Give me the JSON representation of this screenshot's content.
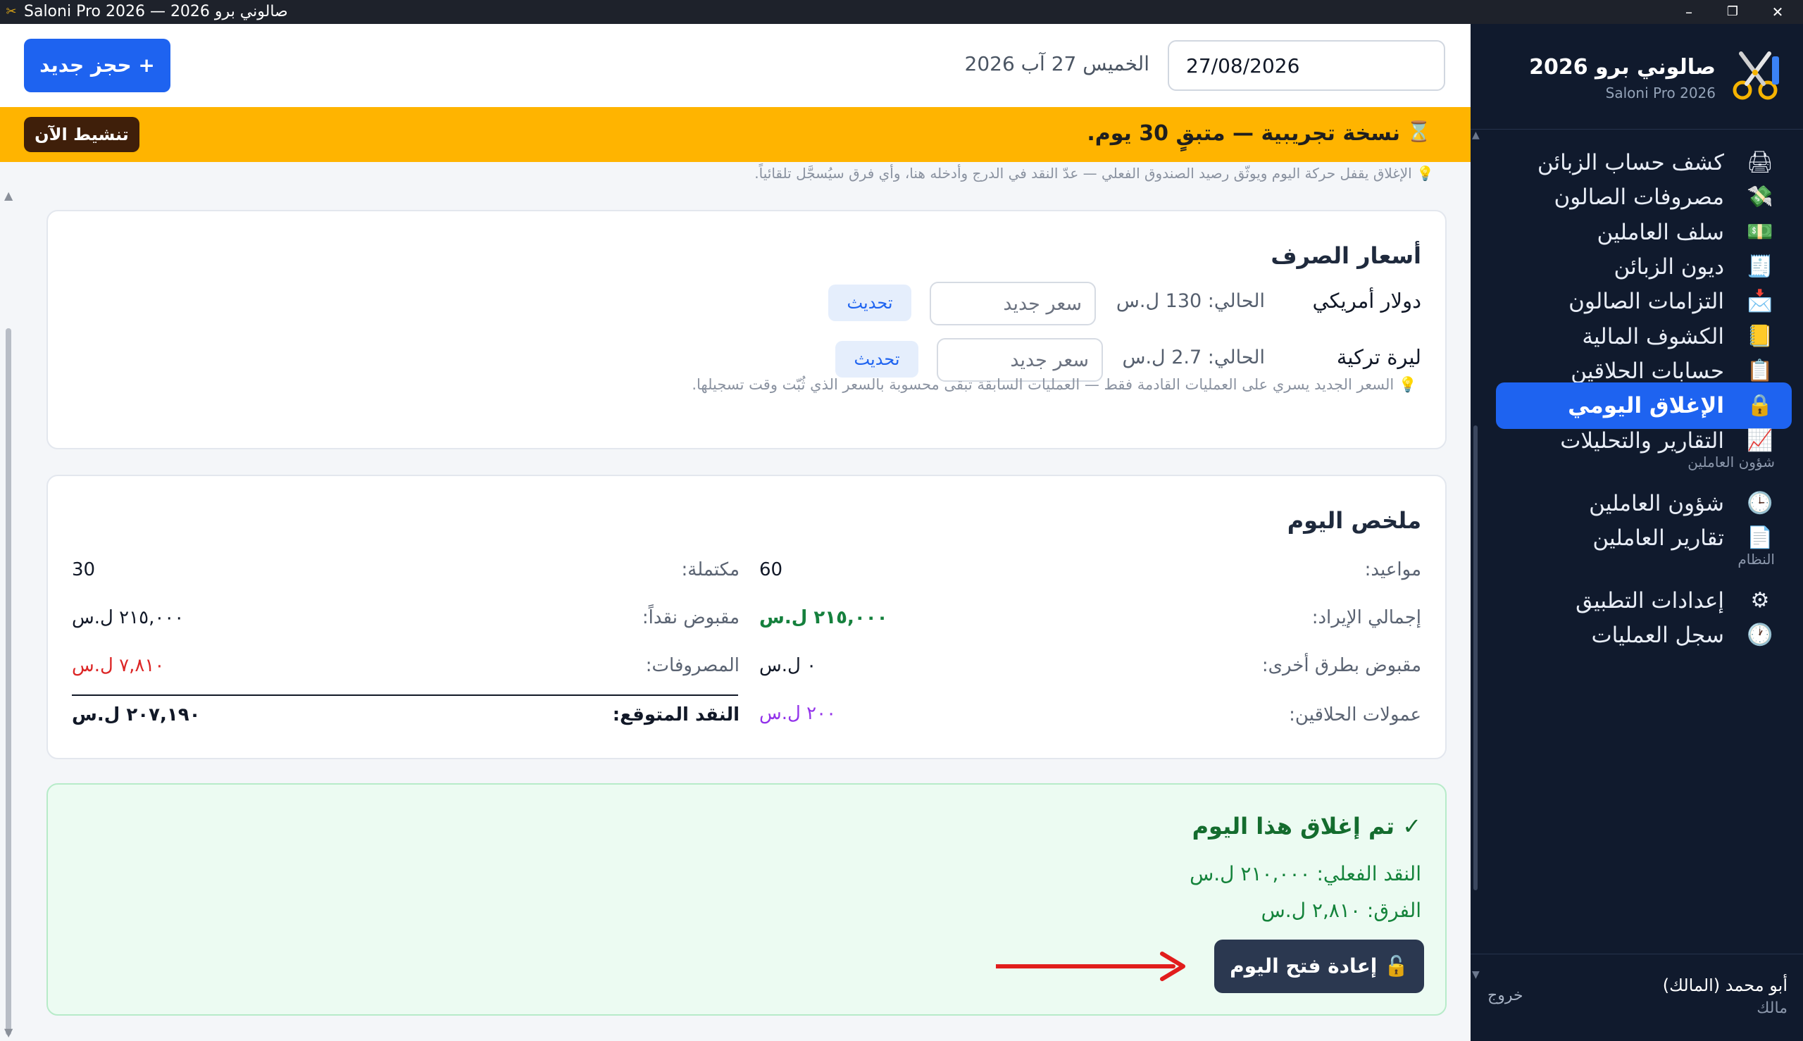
{
  "window": {
    "title": "Saloni Pro 2026 — صالوني برو 2026",
    "minimize_label": "–",
    "maximize_label": "❐",
    "close_label": "✕"
  },
  "sidebar": {
    "brand_title": "صالوني برو 2026",
    "brand_subtitle": "Saloni Pro 2026",
    "items": [
      {
        "label": "كشف حساب الزبائن",
        "icon": "printer-icon",
        "glyph": "🖨"
      },
      {
        "label": "مصروفات الصالون",
        "icon": "money-wings-icon",
        "glyph": "💸"
      },
      {
        "label": "سلف العاملين",
        "icon": "banknote-icon",
        "glyph": "💵"
      },
      {
        "label": "ديون الزبائن",
        "icon": "receipt-icon",
        "glyph": "🧾"
      },
      {
        "label": "التزامات الصالون",
        "icon": "inbox-tray-icon",
        "glyph": "📩"
      },
      {
        "label": "الكشوف المالية",
        "icon": "folder-icon",
        "glyph": "📒"
      },
      {
        "label": "حسابات الحلاقين",
        "icon": "clipboard-icon",
        "glyph": "📋"
      },
      {
        "label": "الإغلاق اليومي",
        "icon": "lock-icon",
        "glyph": "🔒",
        "active": true
      },
      {
        "label": "التقارير والتحليلات",
        "icon": "chart-icon",
        "glyph": "📈"
      }
    ],
    "section_staff": "شؤون العاملين",
    "staff_items": [
      {
        "label": "شؤون العاملين",
        "icon": "clock-icon",
        "glyph": "🕒"
      },
      {
        "label": "تقارير العاملين",
        "icon": "document-icon",
        "glyph": "📄"
      }
    ],
    "section_system": "النظام",
    "system_items": [
      {
        "label": "إعدادات التطبيق",
        "icon": "gear-icon",
        "glyph": "⚙"
      },
      {
        "label": "سجل العمليات",
        "icon": "clock-icon",
        "glyph": "🕐"
      }
    ],
    "user_name": "أبو محمد (المالك)",
    "user_role": "مالك",
    "logout_label": "خروج"
  },
  "topbar": {
    "date_value": "27/08/2026",
    "date_label": "الخميس 27 آب 2026",
    "new_booking_label": "+ حجز جديد"
  },
  "trial": {
    "text": "نسخة تجريبية — متبقٍ 30 يوم.",
    "activate_label": "تنشيط الآن"
  },
  "hint_top": "💡 الإغلاق يقفل حركة اليوم ويوثّق رصيد الصندوق الفعلي — عدّ النقد في الدرج وأدخله هنا، وأي فرق سيُسجَّل تلقائياً.",
  "rates": {
    "title": "أسعار الصرف",
    "rows": [
      {
        "name": "دولار أمريكي",
        "current": "الحالي: 130 ل.س",
        "placeholder": "سعر جديد",
        "button": "تحديث"
      },
      {
        "name": "ليرة تركية",
        "current": "الحالي: 2.7 ل.س",
        "placeholder": "سعر جديد",
        "button": "تحديث"
      }
    ],
    "note": "💡 السعر الجديد يسري على العمليات القادمة فقط — العمليات السابقة تبقى محسوبة بالسعر الذي ثُبّت وقت تسجيلها."
  },
  "summary": {
    "title": "ملخص اليوم",
    "appointments_label": "مواعيد:",
    "appointments_value": "60",
    "completed_label": "مكتملة:",
    "completed_value": "30",
    "revenue_label": "إجمالي الإيراد:",
    "revenue_value": "٢١٥,٠٠٠ ل.س",
    "cash_label": "مقبوض نقداً:",
    "cash_value": "٢١٥,٠٠٠ ل.س",
    "other_label": "مقبوض بطرق أخرى:",
    "other_value": "٠ ل.س",
    "expenses_label": "المصروفات:",
    "expenses_value": "٧,٨١٠ ل.س",
    "commissions_label": "عمولات الحلاقين:",
    "commissions_value": "٢٠٠ ل.س",
    "expected_label": "النقد المتوقع:",
    "expected_value": "٢٠٧,١٩٠ ل.س",
    "colors": {
      "revenue": "#15803d",
      "expenses": "#dc2626",
      "commissions": "#9333ea"
    }
  },
  "closed": {
    "title": "✓ تم إغلاق هذا اليوم",
    "actual_cash": "النقد الفعلي: ٢١٠,٠٠٠ ل.س",
    "difference": "الفرق: ٢,٨١٠ ل.س",
    "reopen_label": "🔓 إعادة فتح اليوم"
  },
  "annotation": {
    "arrow_color": "#e11d1d"
  }
}
